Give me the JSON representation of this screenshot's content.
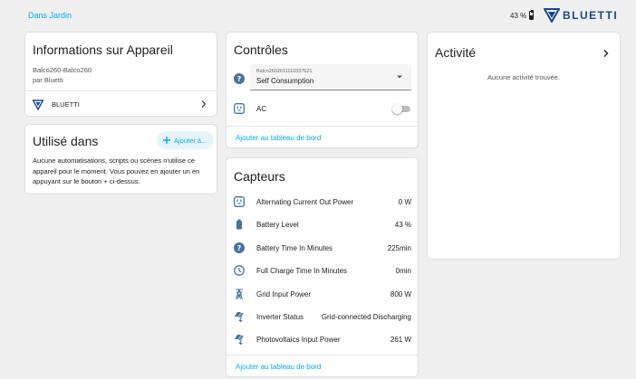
{
  "header": {
    "breadcrumb": "Dans Jardin",
    "battery_text": "43 %",
    "brand": "BLUETTI"
  },
  "device_info": {
    "title": "Informations sur Appareil",
    "model": "Balco260-Balco260",
    "manufacturer": "par Bluetti",
    "integration": "BLUETTI"
  },
  "used_in": {
    "title": "Utilisé dans",
    "add_button": "Ajouter à...",
    "description": "Aucune automatisations, scripts ou scènes n'utilise ce appareil pour le moment. Vous pouvez en ajouter un en appuyant sur le bouton + ci-dessus."
  },
  "controls": {
    "title": "Contrôles",
    "select_label": "Balco2602611110337621",
    "select_value": "Self Consumption",
    "ac_label": "AC",
    "ac_on": false,
    "dashboard_link": "Ajouter au tableau de bord"
  },
  "sensors": {
    "title": "Capteurs",
    "rows": [
      {
        "icon": "power-socket-icon",
        "label": "Alternating Current Out Power",
        "value": "0 W"
      },
      {
        "icon": "battery-icon",
        "label": "Battery Level",
        "value": "43 %"
      },
      {
        "icon": "help-circle-icon",
        "label": "Battery Time In Minutes",
        "value": "225min"
      },
      {
        "icon": "clock-icon",
        "label": "Full Charge Time In Minutes",
        "value": "0min"
      },
      {
        "icon": "transmission-tower-icon",
        "label": "Grid Input Power",
        "value": "800 W"
      },
      {
        "icon": "solar-power-icon",
        "label": "Inverter Status",
        "value": "Grid-connected Discharging"
      },
      {
        "icon": "solar-power-icon",
        "label": "Photovoltaics Input Power",
        "value": "261 W"
      }
    ],
    "dashboard_link": "Ajouter au tableau de bord"
  },
  "activity": {
    "title": "Activité",
    "empty_text": "Aucune activité trouvée."
  },
  "colors": {
    "accent": "#03a9f4",
    "icon": "#44739e",
    "brand": "#1a4a8a"
  }
}
